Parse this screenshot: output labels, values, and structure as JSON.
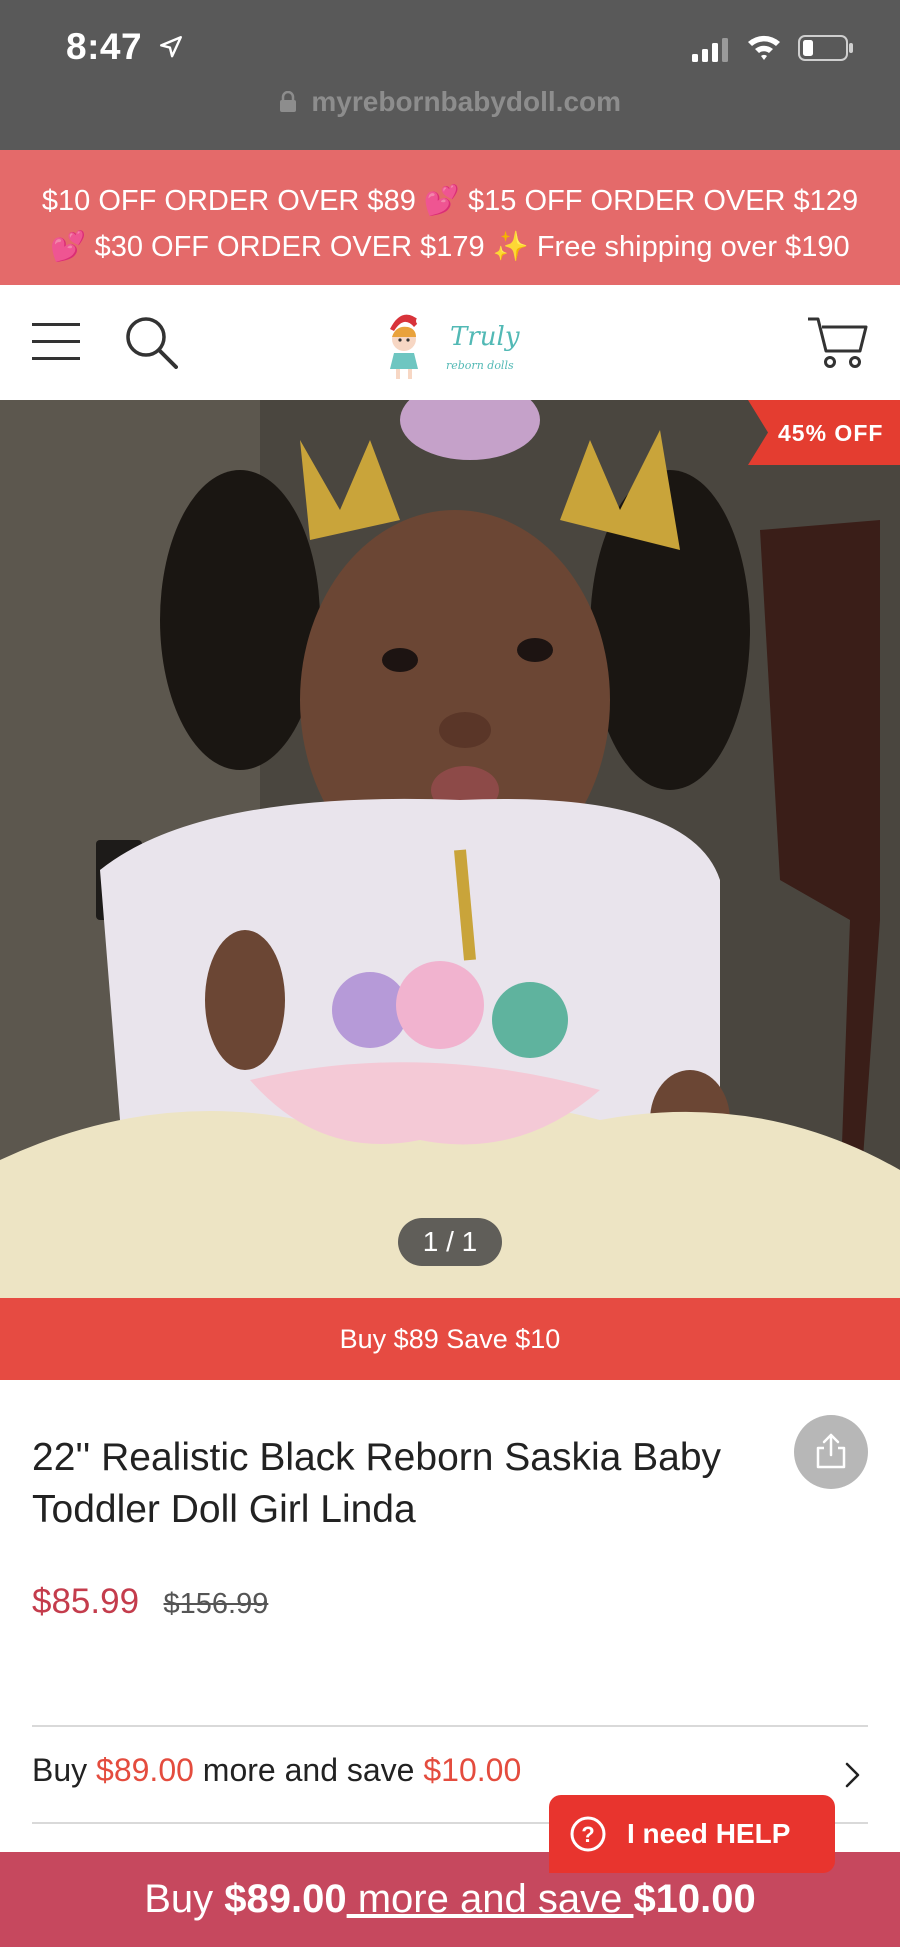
{
  "status_bar": {
    "time": "8:47",
    "url": "myrebornbabydoll.com"
  },
  "promo": {
    "line1": "$10 OFF ORDER OVER $89 💕 $15 OFF ORDER OVER $129",
    "line2": "💕 $30 OFF ORDER OVER $179 ✨ Free shipping over $190"
  },
  "header": {
    "logo_text": "Truly",
    "logo_subtext": "reborn dolls"
  },
  "hero": {
    "badge": "45% OFF",
    "pager": "1 / 1"
  },
  "save_strip": "Buy $89 Save $10",
  "product": {
    "title": "22'' Realistic Black Reborn Saskia Baby Toddler Doll Girl Linda",
    "price": "$85.99",
    "original_price": "$156.99"
  },
  "offer": {
    "prefix": "Buy ",
    "amount": "$89.00",
    "middle": " more and save ",
    "save": "$10.00"
  },
  "help": {
    "label": "I need HELP"
  },
  "bottom_bar": {
    "prefix": "Buy ",
    "amount": "$89.00",
    "middle": " more and save ",
    "save": "$10.00"
  },
  "colors": {
    "promo_bg": "#e46a6a",
    "accent_red": "#e43d30",
    "bottom_bar_bg": "#c6485e",
    "price_red": "#c43c4c"
  }
}
